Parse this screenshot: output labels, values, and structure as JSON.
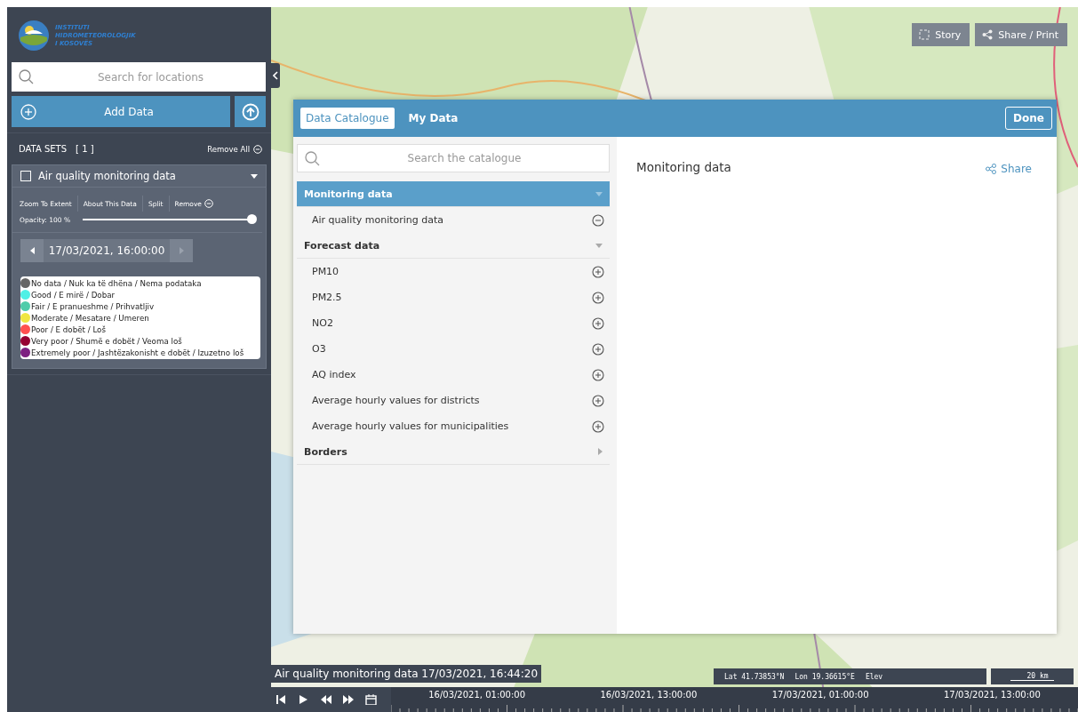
{
  "logo": {
    "lines": [
      "INSTITUTI",
      "HIDROMETEOROLOGJIK",
      "I KOSOVËS"
    ]
  },
  "search": {
    "placeholder": "Search for locations"
  },
  "add_data": {
    "label": "Add Data"
  },
  "data_sets": {
    "title": "DATA SETS",
    "count": "[ 1 ]",
    "remove_all": "Remove All"
  },
  "layer": {
    "title": "Air quality monitoring data",
    "shown": false,
    "actions": [
      "Zoom To Extent",
      "About This Data",
      "Split",
      "Remove"
    ],
    "opacity_label": "Opacity: 100 %",
    "level": 1.0,
    "date": "17/03/2021, 16:00:00",
    "legend": [
      {
        "label": "No data / Nuk ka të dhëna / Nema podataka",
        "color": "#666666"
      },
      {
        "label": "Good / E mirë / Dobar",
        "color": "#50f0e6"
      },
      {
        "label": "Fair / E pranueshme  / Prihvatljiv",
        "color": "#50ccaa"
      },
      {
        "label": "Moderate / Mesatare / Umeren",
        "color": "#f0e641"
      },
      {
        "label": "Poor / E dobët / Loš",
        "color": "#ff5050"
      },
      {
        "label": "Very poor / Shumë e dobët / Veoma loš",
        "color": "#960032"
      },
      {
        "label": "Extremely poor / Jashtëzakonisht e dobët / Izuzetno loš",
        "color": "#7d2181"
      }
    ]
  },
  "map_buttons": [
    "Story",
    "Share / Print"
  ],
  "catalogue": {
    "tabs": [
      {
        "label": "Data Catalogue",
        "selected": true
      },
      {
        "label": "My Data",
        "selected": false
      }
    ],
    "done": "Done",
    "search_placeholder": "Search the catalogue",
    "groups": [
      {
        "label": "Monitoring data",
        "selected": true,
        "expanded": true,
        "children": [
          {
            "label": "Air quality monitoring data",
            "added": true
          }
        ]
      },
      {
        "label": "Forecast data",
        "selected": false,
        "expanded": true,
        "children": [
          {
            "label": "PM10",
            "added": false
          },
          {
            "label": "PM2.5",
            "added": false
          },
          {
            "label": "NO2",
            "added": false
          },
          {
            "label": "O3",
            "added": false
          },
          {
            "label": "AQ index",
            "added": false
          },
          {
            "label": "Average hourly values for districts",
            "added": false
          },
          {
            "label": "Average hourly values for municipalities",
            "added": false
          }
        ]
      },
      {
        "label": "Borders",
        "selected": false,
        "expanded": false
      }
    ],
    "preview_title": "Monitoring data",
    "share": "Share"
  },
  "status": {
    "layer_time": "Air quality monitoring data 17/03/2021, 16:44:20",
    "lat_label": "Lat",
    "lat": "41.73853°N",
    "lon_label": "Lon",
    "lon": "19.36615°E",
    "elev_label": "Elev",
    "scale": "20 km"
  },
  "timeline": {
    "ticks": [
      "16/03/2021, 01:00:00",
      "16/03/2021, 13:00:00",
      "17/03/2021, 01:00:00",
      "17/03/2021, 13:00:00"
    ]
  }
}
